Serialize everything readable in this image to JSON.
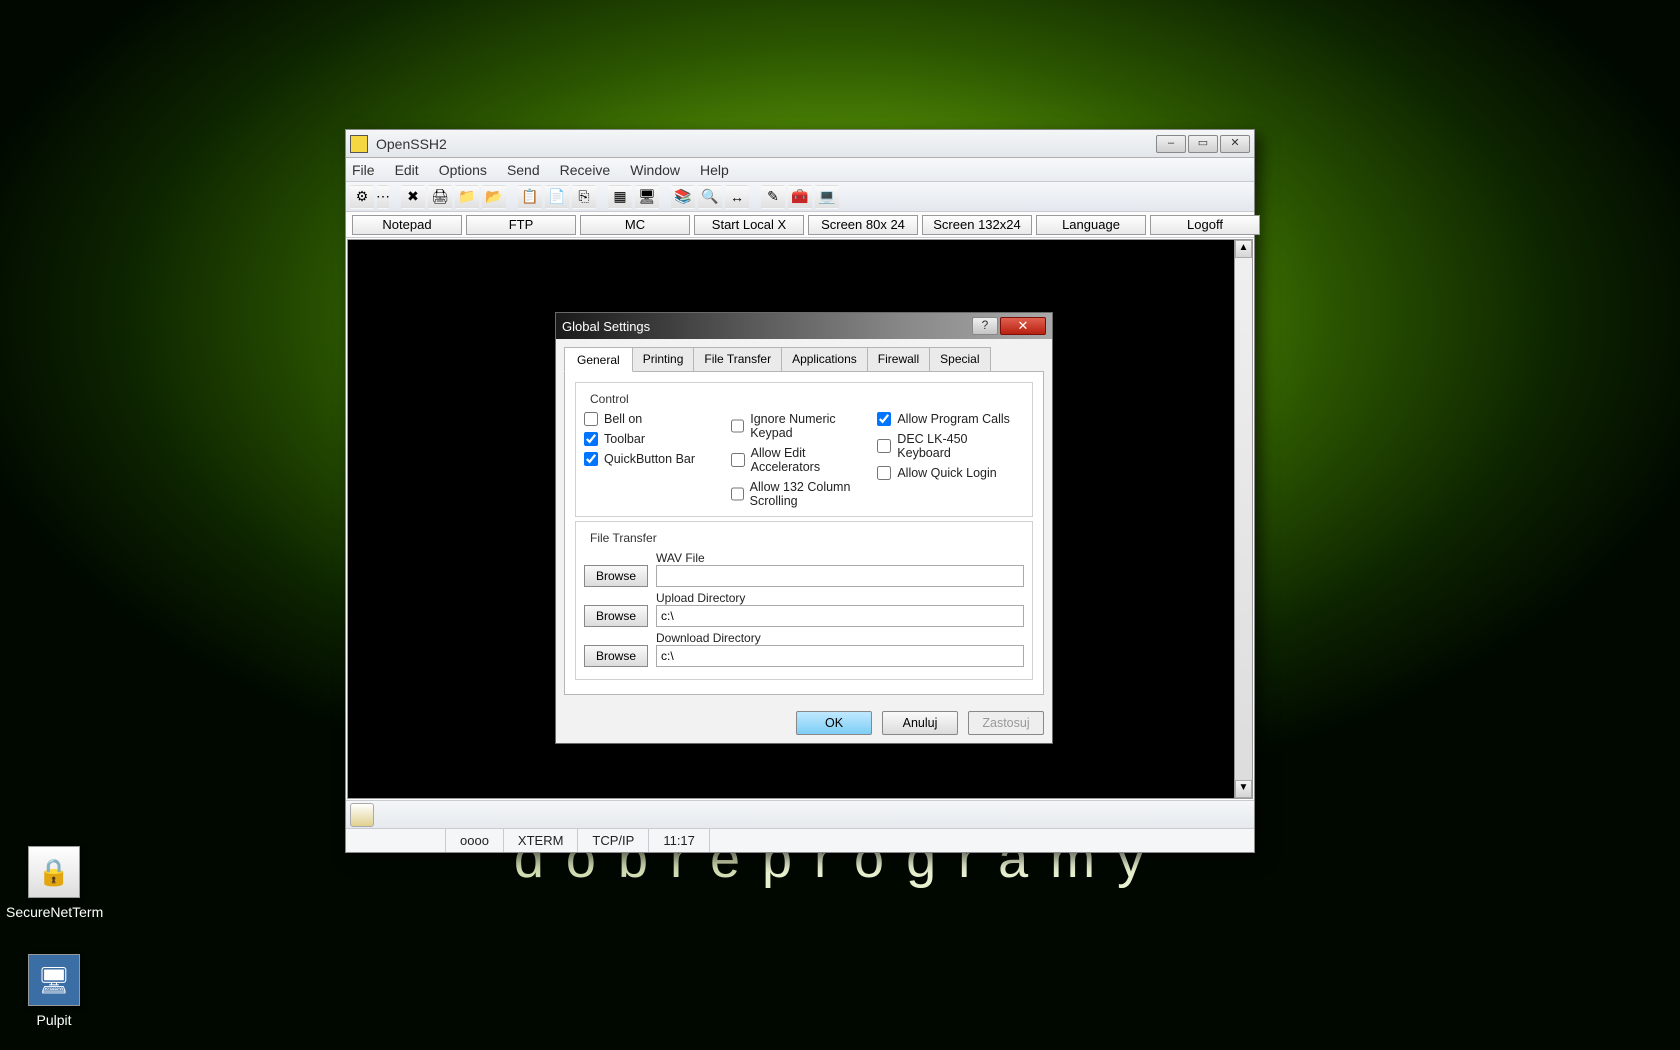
{
  "desktop": {
    "watermark_light": "dobre",
    "watermark_bold": "programy",
    "icons": [
      {
        "label": "SecureNetTerm",
        "glyph": "🔒"
      },
      {
        "label": "Pulpit",
        "glyph": "🖥"
      }
    ]
  },
  "window": {
    "title": "OpenSSH2",
    "winbtns": {
      "min": "–",
      "max": "▭",
      "close": "✕"
    },
    "menu": [
      "File",
      "Edit",
      "Options",
      "Send",
      "Receive",
      "Window",
      "Help"
    ],
    "toolbar_glyphs": [
      "⚙",
      "⋯",
      "✖",
      "🖨",
      "📁",
      "📂",
      "📋",
      "📄",
      "⎘",
      "▦",
      "🖥",
      "📚",
      "🔍",
      "↔",
      "✎",
      "🧰",
      "💻"
    ],
    "quickbuttons": [
      "Notepad",
      "FTP",
      "MC",
      "Start Local X",
      "Screen 80x 24",
      "Screen 132x24",
      "Language",
      "Logoff"
    ],
    "status": {
      "oooo": "oooo",
      "term": "XTERM",
      "proto": "TCP/IP",
      "time": "11:17"
    }
  },
  "dialog": {
    "title": "Global Settings",
    "tabs": [
      "General",
      "Printing",
      "File Transfer",
      "Applications",
      "Firewall",
      "Special"
    ],
    "active_tab": "General",
    "groups": {
      "control": {
        "legend": "Control",
        "col1": [
          {
            "label": "Bell on",
            "checked": false
          },
          {
            "label": "Toolbar",
            "checked": true
          },
          {
            "label": "QuickButton Bar",
            "checked": true
          }
        ],
        "col2": [
          {
            "label": "Ignore Numeric Keypad",
            "checked": false
          },
          {
            "label": "Allow Edit Accelerators",
            "checked": false
          },
          {
            "label": "Allow 132 Column Scrolling",
            "checked": false
          }
        ],
        "col3": [
          {
            "label": "Allow Program Calls",
            "checked": true
          },
          {
            "label": "DEC LK-450 Keyboard",
            "checked": false
          },
          {
            "label": "Allow Quick Login",
            "checked": false
          }
        ]
      },
      "filetransfer": {
        "legend": "File Transfer",
        "wav_label": "WAV File",
        "wav_value": "",
        "upload_label": "Upload Directory",
        "upload_value": "c:\\",
        "download_label": "Download Directory",
        "download_value": "c:\\",
        "browse": "Browse"
      }
    },
    "buttons": {
      "ok": "OK",
      "cancel": "Anuluj",
      "apply": "Zastosuj"
    }
  }
}
